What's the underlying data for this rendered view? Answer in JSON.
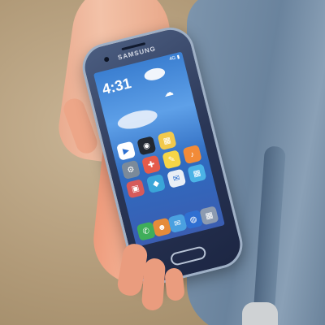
{
  "phone": {
    "brand": "SAMSUNG",
    "status_bar": "4G ▮",
    "clock": "4:31",
    "date_line": "",
    "weather_icon": "cloud-icon"
  },
  "apps": [
    {
      "name": "play-store-icon",
      "glyph": "▶",
      "color": "#ffffff"
    },
    {
      "name": "camera-icon",
      "glyph": "◉",
      "color": "#222831"
    },
    {
      "name": "gallery-icon",
      "glyph": "▦",
      "color": "#f2c94c"
    },
    {
      "name": "blank-app-icon",
      "glyph": "",
      "color": "transparent"
    },
    {
      "name": "settings-icon",
      "glyph": "⚙",
      "color": "#7b8a9a"
    },
    {
      "name": "maps-icon",
      "glyph": "✚",
      "color": "#e55b4b"
    },
    {
      "name": "memo-icon",
      "glyph": "✎",
      "color": "#f5d547"
    },
    {
      "name": "music-icon",
      "glyph": "♪",
      "color": "#f28b38"
    },
    {
      "name": "video-icon",
      "glyph": "▣",
      "color": "#d65a5a"
    },
    {
      "name": "store-icon",
      "glyph": "◆",
      "color": "#3aa5d8"
    },
    {
      "name": "email-icon",
      "glyph": "✉",
      "color": "#e9eef5"
    },
    {
      "name": "apps-grid-icon",
      "glyph": "▦",
      "color": "#4bb3e6"
    }
  ],
  "dock": [
    {
      "name": "phone-icon",
      "glyph": "✆",
      "color": "#3fae5a"
    },
    {
      "name": "contacts-icon",
      "glyph": "☻",
      "color": "#e58b3a"
    },
    {
      "name": "messages-icon",
      "glyph": "✉",
      "color": "#4aa0e0"
    },
    {
      "name": "internet-icon",
      "glyph": "◍",
      "color": "#2f6fd1"
    },
    {
      "name": "apps-icon",
      "glyph": "▦",
      "color": "#8d9bb0"
    }
  ]
}
